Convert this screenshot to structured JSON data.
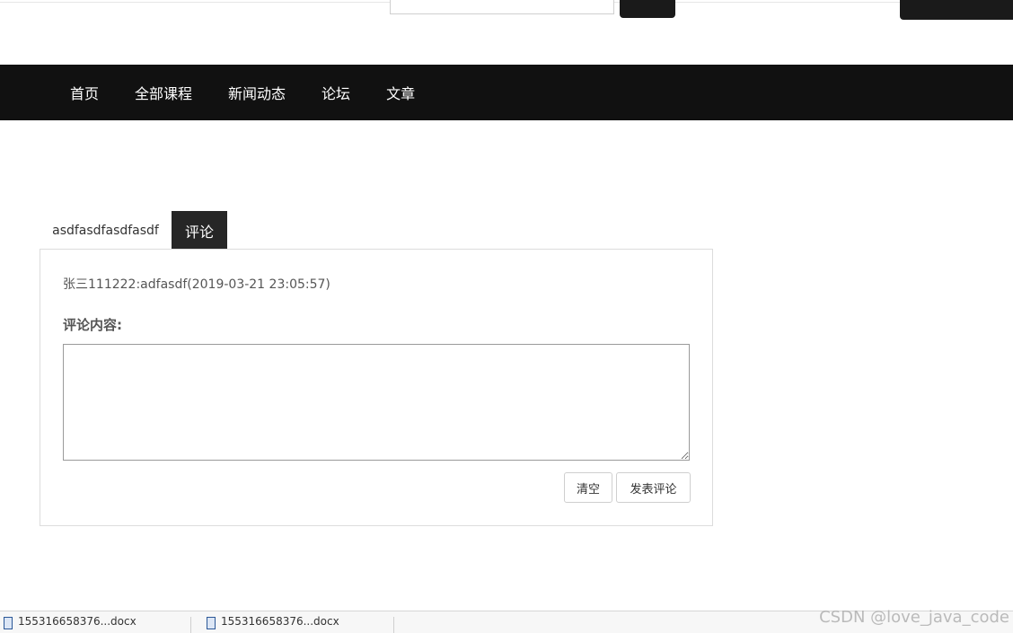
{
  "nav": {
    "items": [
      {
        "label": "首页"
      },
      {
        "label": "全部课程"
      },
      {
        "label": "新闻动态"
      },
      {
        "label": "论坛"
      },
      {
        "label": "文章"
      }
    ]
  },
  "tabs": {
    "article_title": "asdfasdfasdfasdf",
    "comments_label": "评论"
  },
  "comments": {
    "author": "张三111222",
    "text": ":adfasdf",
    "time": "(2019-03-21 23:05:57)"
  },
  "form": {
    "label": "评论内容:",
    "textarea_value": "",
    "clear_label": "清空",
    "post_label": "发表评论"
  },
  "downloads": {
    "items": [
      {
        "name": "155316658376...docx"
      },
      {
        "name": "155316658376...docx"
      }
    ]
  },
  "watermark": "CSDN @love_java_code",
  "colors": {
    "navbar_bg": "#111111",
    "active_tab_bg": "#262626"
  }
}
